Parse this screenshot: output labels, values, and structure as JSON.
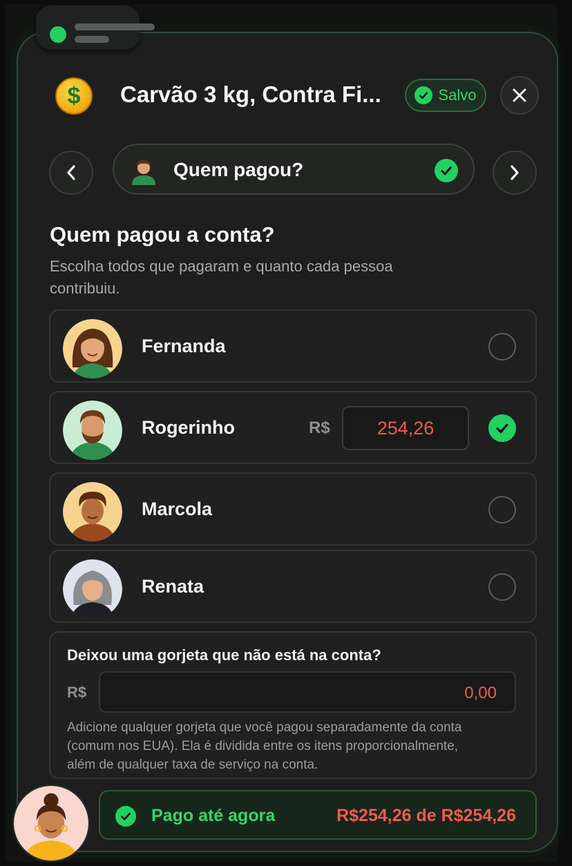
{
  "app": {
    "title": "Carvão 3 kg, Contra Fi...",
    "saved_badge": "Salvo",
    "icons": {
      "coin": "dollar-coin-icon",
      "close": "close-icon",
      "prev": "chevron-left-icon",
      "next": "chevron-right-icon"
    }
  },
  "stepper": {
    "label": "Quem pagou?",
    "completed": true
  },
  "section": {
    "title": "Quem pagou a conta?",
    "subtitle": "Escolha todos que pagaram e quanto cada pessoa contribuiu."
  },
  "people": [
    {
      "name": "Fernanda",
      "selected": false
    },
    {
      "name": "Rogerinho",
      "selected": true,
      "currency": "R$",
      "amount": "254,26"
    },
    {
      "name": "Marcola",
      "selected": false
    },
    {
      "name": "Renata",
      "selected": false
    }
  ],
  "tip": {
    "title": "Deixou uma gorjeta que não está na conta?",
    "currency": "R$",
    "value": "0,00",
    "help": "Adicione qualquer gorjeta que você pagou separadamente da conta (comum nos EUA). Ela é dividida entre os itens proporcionalmente, além de qualquer taxa de serviço na conta."
  },
  "summary": {
    "label": "Pago até agora",
    "amount": "R$254,26 de R$254,26"
  },
  "colors": {
    "accent_green": "#22d160",
    "amount_red": "#ef5a52",
    "card_bg": "#1d1e1d",
    "border_green": "#2f4a38"
  }
}
